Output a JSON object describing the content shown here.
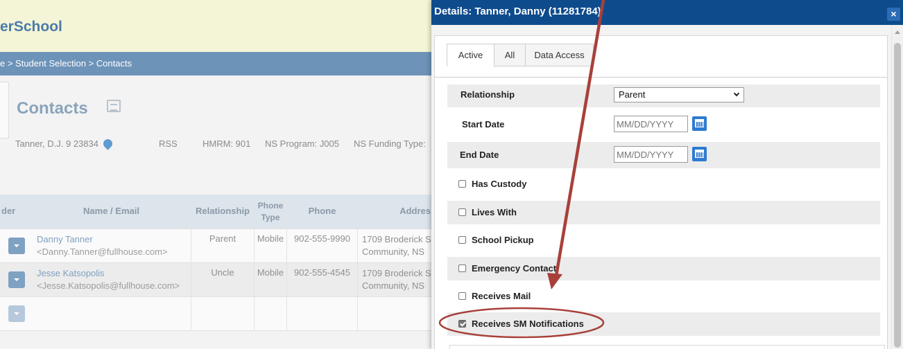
{
  "background_page": {
    "logo_text": "erSchool",
    "breadcrumb": "e > Student Selection > Contacts",
    "page_title": "Contacts",
    "student_bar": {
      "name_grade_id": "Tanner, D.J.  9  23834",
      "school": "RSS",
      "hmrm": "HMRM: 901",
      "program": "NS Program: J005",
      "funding": "NS Funding Type:"
    },
    "table": {
      "headers": [
        "der",
        "Name / Email",
        "Relationship",
        "Phone Type",
        "Phone",
        "Addres"
      ],
      "rows": [
        {
          "name": "Danny Tanner",
          "email": "<Danny.Tanner@fullhouse.com>",
          "relationship": "Parent",
          "phone_type": "Mobile",
          "phone": "902-555-9990",
          "address_line1": "1709 Broderick S",
          "address_line2": "Community, NS"
        },
        {
          "name": "Jesse Katsopolis",
          "email": "<Jesse.Katsopolis@fullhouse.com>",
          "relationship": "Uncle",
          "phone_type": "Mobile",
          "phone": "902-555-4545",
          "address_line1": "1709 Broderick S",
          "address_line2": "Community, NS"
        }
      ]
    }
  },
  "modal": {
    "title": "Details: Tanner, Danny (11281784)",
    "close_glyph": "×",
    "tabs": [
      {
        "label": "Active",
        "active": true
      },
      {
        "label": "All",
        "active": false
      },
      {
        "label": "Data Access",
        "active": false
      }
    ],
    "fields": {
      "relationship": {
        "label": "Relationship",
        "value": "Parent"
      },
      "start_date": {
        "label": "Start Date",
        "placeholder": "MM/DD/YYYY"
      },
      "end_date": {
        "label": "End Date",
        "placeholder": "MM/DD/YYYY"
      }
    },
    "checkboxes": [
      {
        "label": "Has Custody",
        "checked": false
      },
      {
        "label": "Lives With",
        "checked": false
      },
      {
        "label": "School Pickup",
        "checked": false
      },
      {
        "label": "Emergency Contact",
        "checked": false
      },
      {
        "label": "Receives Mail",
        "checked": false
      },
      {
        "label": "Receives SM Notifications",
        "checked": true
      }
    ]
  },
  "annotation": {
    "arrow_color": "#a8403a",
    "highlight_color": "#a8403a"
  },
  "colors": {
    "modal_header": "#0e4b8c",
    "calendar_button": "#2d7bd0",
    "breadcrumb_bar": "#6d93b8",
    "header_bar": "#f4f5d6"
  }
}
